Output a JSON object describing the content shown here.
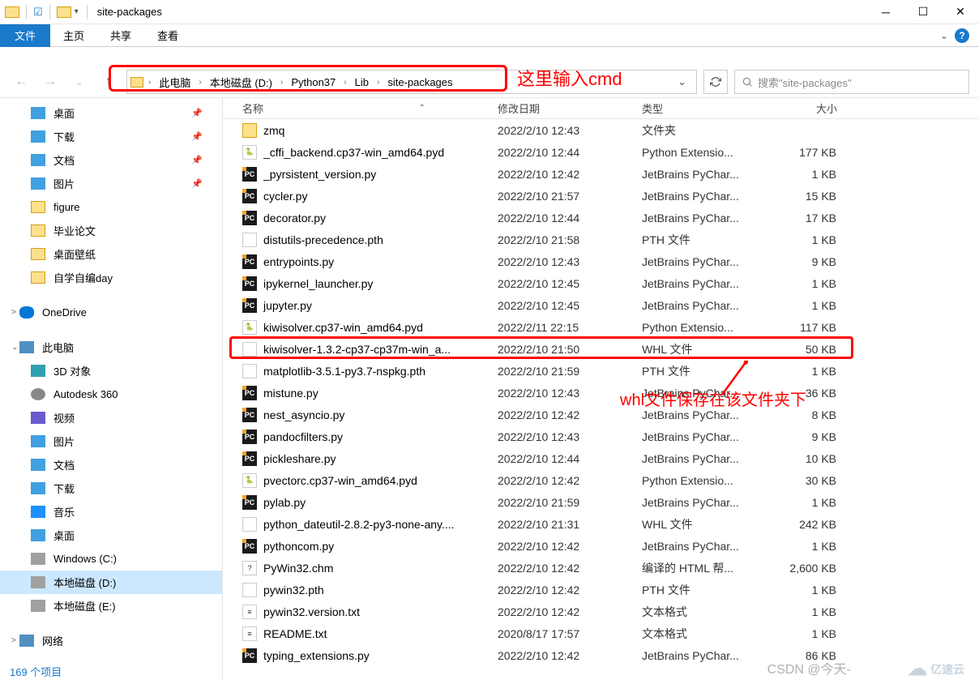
{
  "window": {
    "title": "site-packages"
  },
  "ribbon": {
    "file": "文件",
    "tabs": [
      "主页",
      "共享",
      "查看"
    ]
  },
  "nav": {
    "breadcrumb": [
      "此电脑",
      "本地磁盘 (D:)",
      "Python37",
      "Lib",
      "site-packages"
    ],
    "search_placeholder": "搜索\"site-packages\""
  },
  "annotations": {
    "bc_text": "这里输入cmd",
    "whl_text": "whl文件保存在该文件夹下"
  },
  "sidebar": {
    "quick": [
      {
        "label": "桌面",
        "pin": true,
        "cls": "ico-desktop"
      },
      {
        "label": "下载",
        "pin": true,
        "cls": "ico-download"
      },
      {
        "label": "文档",
        "pin": true,
        "cls": "ico-doc"
      },
      {
        "label": "图片",
        "pin": true,
        "cls": "ico-pic"
      },
      {
        "label": "figure",
        "pin": false,
        "cls": "ico-folder"
      },
      {
        "label": "毕业论文",
        "pin": false,
        "cls": "ico-folder"
      },
      {
        "label": "桌面壁纸",
        "pin": false,
        "cls": "ico-folder"
      },
      {
        "label": "自学自编day",
        "pin": false,
        "cls": "ico-folder"
      }
    ],
    "onedrive": "OneDrive",
    "thispc": {
      "label": "此电脑",
      "items": [
        {
          "label": "3D 对象",
          "cls": "ico-3d"
        },
        {
          "label": "Autodesk 360",
          "cls": "ico-autodesk"
        },
        {
          "label": "视频",
          "cls": "ico-video"
        },
        {
          "label": "图片",
          "cls": "ico-pic"
        },
        {
          "label": "文档",
          "cls": "ico-doc"
        },
        {
          "label": "下载",
          "cls": "ico-download"
        },
        {
          "label": "音乐",
          "cls": "ico-music"
        },
        {
          "label": "桌面",
          "cls": "ico-desktop"
        },
        {
          "label": "Windows (C:)",
          "cls": "ico-drive"
        },
        {
          "label": "本地磁盘 (D:)",
          "cls": "ico-drive",
          "selected": true
        },
        {
          "label": "本地磁盘 (E:)",
          "cls": "ico-drive"
        }
      ]
    },
    "network": "网络"
  },
  "columns": {
    "name": "名称",
    "date": "修改日期",
    "type": "类型",
    "size": "大小"
  },
  "files": [
    {
      "icon": "folder",
      "name": "zmq",
      "date": "2022/2/10 12:43",
      "type": "文件夹",
      "size": ""
    },
    {
      "icon": "py",
      "name": "_cffi_backend.cp37-win_amd64.pyd",
      "date": "2022/2/10 12:44",
      "type": "Python Extensio...",
      "size": "177 KB"
    },
    {
      "icon": "pc",
      "name": "_pyrsistent_version.py",
      "date": "2022/2/10 12:42",
      "type": "JetBrains PyChar...",
      "size": "1 KB"
    },
    {
      "icon": "pc",
      "name": "cycler.py",
      "date": "2022/2/10 21:57",
      "type": "JetBrains PyChar...",
      "size": "15 KB"
    },
    {
      "icon": "pc",
      "name": "decorator.py",
      "date": "2022/2/10 12:44",
      "type": "JetBrains PyChar...",
      "size": "17 KB"
    },
    {
      "icon": "file",
      "name": "distutils-precedence.pth",
      "date": "2022/2/10 21:58",
      "type": "PTH 文件",
      "size": "1 KB"
    },
    {
      "icon": "pc",
      "name": "entrypoints.py",
      "date": "2022/2/10 12:43",
      "type": "JetBrains PyChar...",
      "size": "9 KB"
    },
    {
      "icon": "pc",
      "name": "ipykernel_launcher.py",
      "date": "2022/2/10 12:45",
      "type": "JetBrains PyChar...",
      "size": "1 KB"
    },
    {
      "icon": "pc",
      "name": "jupyter.py",
      "date": "2022/2/10 12:45",
      "type": "JetBrains PyChar...",
      "size": "1 KB"
    },
    {
      "icon": "py",
      "name": "kiwisolver.cp37-win_amd64.pyd",
      "date": "2022/2/11 22:15",
      "type": "Python Extensio...",
      "size": "117 KB"
    },
    {
      "icon": "file",
      "name": "kiwisolver-1.3.2-cp37-cp37m-win_a...",
      "date": "2022/2/10 21:50",
      "type": "WHL 文件",
      "size": "50 KB",
      "hl": true
    },
    {
      "icon": "file",
      "name": "matplotlib-3.5.1-py3.7-nspkg.pth",
      "date": "2022/2/10 21:59",
      "type": "PTH 文件",
      "size": "1 KB"
    },
    {
      "icon": "pc",
      "name": "mistune.py",
      "date": "2022/2/10 12:43",
      "type": "JetBrains PyChar...",
      "size": "36 KB"
    },
    {
      "icon": "pc",
      "name": "nest_asyncio.py",
      "date": "2022/2/10 12:42",
      "type": "JetBrains PyChar...",
      "size": "8 KB"
    },
    {
      "icon": "pc",
      "name": "pandocfilters.py",
      "date": "2022/2/10 12:43",
      "type": "JetBrains PyChar...",
      "size": "9 KB"
    },
    {
      "icon": "pc",
      "name": "pickleshare.py",
      "date": "2022/2/10 12:44",
      "type": "JetBrains PyChar...",
      "size": "10 KB"
    },
    {
      "icon": "py",
      "name": "pvectorc.cp37-win_amd64.pyd",
      "date": "2022/2/10 12:42",
      "type": "Python Extensio...",
      "size": "30 KB"
    },
    {
      "icon": "pc",
      "name": "pylab.py",
      "date": "2022/2/10 21:59",
      "type": "JetBrains PyChar...",
      "size": "1 KB"
    },
    {
      "icon": "file",
      "name": "python_dateutil-2.8.2-py3-none-any....",
      "date": "2022/2/10 21:31",
      "type": "WHL 文件",
      "size": "242 KB"
    },
    {
      "icon": "pc",
      "name": "pythoncom.py",
      "date": "2022/2/10 12:42",
      "type": "JetBrains PyChar...",
      "size": "1 KB"
    },
    {
      "icon": "chm",
      "name": "PyWin32.chm",
      "date": "2022/2/10 12:42",
      "type": "编译的 HTML 帮...",
      "size": "2,600 KB"
    },
    {
      "icon": "file",
      "name": "pywin32.pth",
      "date": "2022/2/10 12:42",
      "type": "PTH 文件",
      "size": "1 KB"
    },
    {
      "icon": "txt",
      "name": "pywin32.version.txt",
      "date": "2022/2/10 12:42",
      "type": "文本格式",
      "size": "1 KB"
    },
    {
      "icon": "txt",
      "name": "README.txt",
      "date": "2020/8/17 17:57",
      "type": "文本格式",
      "size": "1 KB"
    },
    {
      "icon": "pc",
      "name": "typing_extensions.py",
      "date": "2022/2/10 12:42",
      "type": "JetBrains PyChar...",
      "size": "86 KB"
    }
  ],
  "status": "169 个项目",
  "watermark": {
    "csdn": "CSDN @今天-",
    "yisu": "亿速云"
  }
}
